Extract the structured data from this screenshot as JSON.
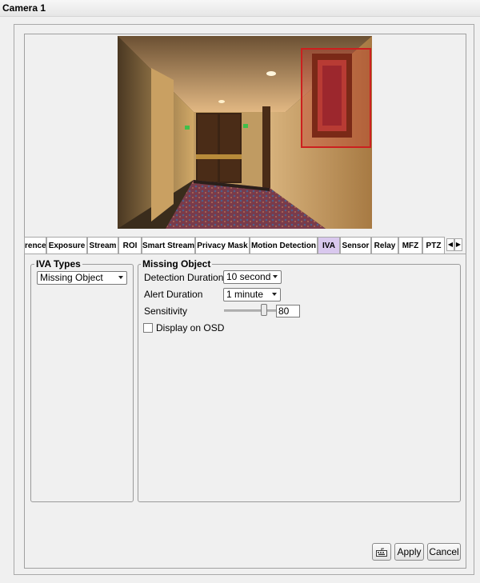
{
  "window": {
    "title": "Camera 1"
  },
  "tabs": [
    {
      "label": "rence",
      "active": false
    },
    {
      "label": "Exposure",
      "active": false
    },
    {
      "label": "Stream",
      "active": false
    },
    {
      "label": "ROI",
      "active": false
    },
    {
      "label": "Smart Stream",
      "active": false
    },
    {
      "label": "Privacy Mask",
      "active": false
    },
    {
      "label": "Motion Detection",
      "active": false
    },
    {
      "label": "IVA",
      "active": true
    },
    {
      "label": "Sensor",
      "active": false
    },
    {
      "label": "Relay",
      "active": false
    },
    {
      "label": "MFZ",
      "active": false
    },
    {
      "label": "PTZ",
      "active": false
    }
  ],
  "iva_types": {
    "legend": "IVA Types",
    "selected": "Missing Object"
  },
  "missing_object": {
    "legend": "Missing Object",
    "detection_duration": {
      "label": "Detection Duration",
      "value": "10 second"
    },
    "alert_duration": {
      "label": "Alert Duration",
      "value": "1 minute"
    },
    "sensitivity": {
      "label": "Sensitivity",
      "value": "80",
      "level": 0.8
    },
    "display_osd": {
      "label": "Display on OSD",
      "checked": false
    }
  },
  "buttons": {
    "apply": "Apply",
    "cancel": "Cancel",
    "keyboard_icon": "keyboard-icon"
  },
  "colors": {
    "active_tab": "#d9c8ee",
    "roi_box": "#cc1f1f"
  }
}
